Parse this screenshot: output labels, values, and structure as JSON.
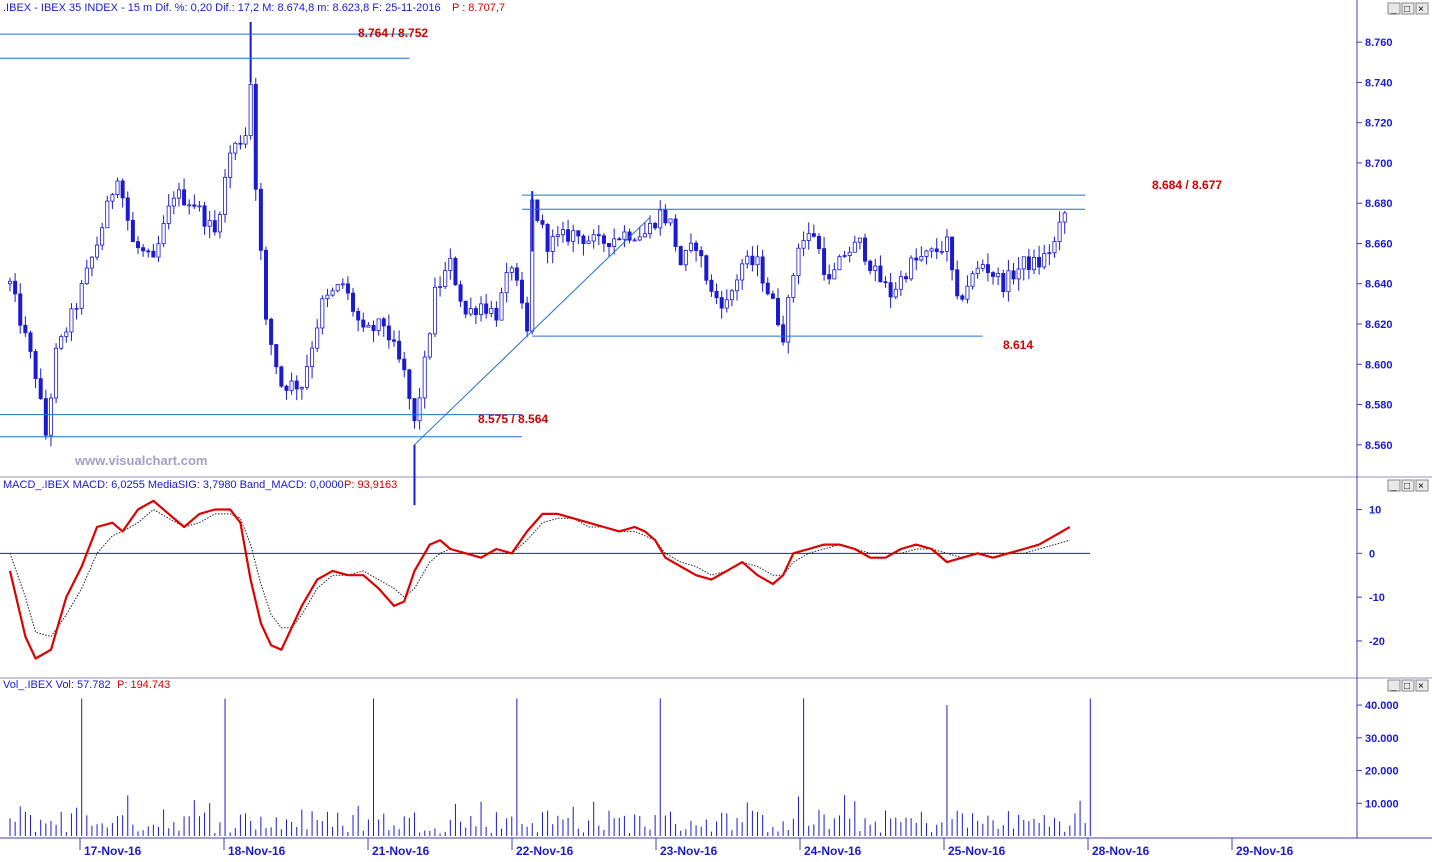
{
  "header": {
    "price_info": ".IBEX - IBEX 35 INDEX -  15 m  Dif. %: 0,20  Dif.: 17,2  M: 8.674,8  m: 8.623,8  F: 25-11-2016",
    "price_last": "P : 8.707,7",
    "macd_info": "MACD_.IBEX MACD: 6,0255  MediaSIG: 3,7980  Band_MACD: 0,0000",
    "macd_last": "P: 93,9163",
    "vol_info": "Vol_.IBEX Vol: 57.782",
    "vol_last": "P: 194.743"
  },
  "watermark": "www.visualchart.com",
  "window_buttons": [
    "_",
    "□",
    "×"
  ],
  "colors": {
    "price": "#1a1ad0",
    "macd": "#dd0000",
    "signal": "#202020",
    "trendline": "#1f6fd0",
    "annotation": "#d00000",
    "axis_text": "#1a1ad0",
    "frame": "#4040b0"
  },
  "annotations": {
    "a_top": "8.764 / 8.752",
    "a_mid": "8.684 / 8.677",
    "a_support": "8.614",
    "a_low": "8.575 / 8.564"
  },
  "chart_data": [
    {
      "type": "candlestick",
      "name": "IBEX 35 INDEX 15 m",
      "ylim": [
        8545,
        8772
      ],
      "yticks": [
        8560,
        8580,
        8600,
        8620,
        8640,
        8660,
        8680,
        8700,
        8720,
        8740,
        8760
      ],
      "ytick_labels": [
        "8.560",
        "8.580",
        "8.600",
        "8.620",
        "8.640",
        "8.660",
        "8.680",
        "8.700",
        "8.720",
        "8.740",
        "8.760"
      ],
      "x_dates": [
        "17-Nov-16",
        "18-Nov-16",
        "21-Nov-16",
        "22-Nov-16",
        "23-Nov-16",
        "24-Nov-16",
        "25-Nov-16",
        "28-Nov-16",
        "29-Nov-16"
      ],
      "bars_per_session": 35,
      "anchors": [
        [
          0,
          8640
        ],
        [
          5,
          8595
        ],
        [
          7,
          8565
        ],
        [
          9,
          8605
        ],
        [
          13,
          8630
        ],
        [
          17,
          8660
        ],
        [
          21,
          8695
        ],
        [
          24,
          8660
        ],
        [
          28,
          8650
        ],
        [
          32,
          8685
        ],
        [
          36,
          8680
        ],
        [
          40,
          8665
        ],
        [
          43,
          8705
        ],
        [
          46,
          8715
        ],
        [
          47,
          8740
        ],
        [
          48,
          8690
        ],
        [
          50,
          8620
        ],
        [
          53,
          8590
        ],
        [
          57,
          8590
        ],
        [
          61,
          8630
        ],
        [
          65,
          8640
        ],
        [
          69,
          8615
        ],
        [
          73,
          8620
        ],
        [
          77,
          8595
        ],
        [
          79,
          8570
        ],
        [
          81,
          8600
        ],
        [
          83,
          8635
        ],
        [
          86,
          8650
        ],
        [
          89,
          8625
        ],
        [
          92,
          8630
        ],
        [
          95,
          8625
        ],
        [
          98,
          8650
        ],
        [
          101,
          8615
        ],
        [
          102,
          8680
        ],
        [
          105,
          8660
        ],
        [
          110,
          8665
        ],
        [
          115,
          8660
        ],
        [
          120,
          8665
        ],
        [
          124,
          8665
        ],
        [
          127,
          8675
        ],
        [
          129,
          8670
        ],
        [
          131,
          8650
        ],
        [
          134,
          8660
        ],
        [
          137,
          8635
        ],
        [
          140,
          8630
        ],
        [
          143,
          8650
        ],
        [
          146,
          8650
        ],
        [
          149,
          8630
        ],
        [
          151,
          8615
        ],
        [
          154,
          8660
        ],
        [
          157,
          8665
        ],
        [
          160,
          8640
        ],
        [
          163,
          8655
        ],
        [
          166,
          8660
        ],
        [
          169,
          8645
        ],
        [
          172,
          8635
        ],
        [
          176,
          8650
        ],
        [
          180,
          8655
        ],
        [
          183,
          8660
        ],
        [
          185,
          8630
        ],
        [
          187,
          8640
        ],
        [
          190,
          8650
        ],
        [
          194,
          8640
        ],
        [
          198,
          8650
        ],
        [
          201,
          8650
        ],
        [
          204,
          8660
        ],
        [
          206,
          8675
        ]
      ],
      "lines": [
        {
          "label_key": "a_top",
          "levels": [
            8764,
            8752
          ],
          "from_bar": -2,
          "to_bar": 78
        },
        {
          "label_key": "a_mid",
          "levels": [
            8684,
            8677
          ],
          "from_bar": 100,
          "to_bar": 210
        },
        {
          "label_key": "a_support",
          "levels": [
            8614
          ],
          "from_bar": 102,
          "to_bar": 190
        },
        {
          "label_key": "a_low",
          "levels": [
            8575,
            8564
          ],
          "from_bar": -2,
          "to_bar": 100
        }
      ],
      "trendline": {
        "from": [
          79,
          8560
        ],
        "to": [
          125,
          8673
        ]
      }
    },
    {
      "type": "line",
      "name": "MACD",
      "ylim": [
        -28,
        14
      ],
      "yticks": [
        10,
        0,
        -10,
        -20
      ],
      "ytick_labels": [
        "10",
        "0",
        "-10",
        "-20"
      ],
      "zero_line": 0,
      "macd": [
        [
          0,
          -4
        ],
        [
          3,
          -19
        ],
        [
          5,
          -24
        ],
        [
          8,
          -22
        ],
        [
          11,
          -10
        ],
        [
          14,
          -3
        ],
        [
          17,
          6
        ],
        [
          20,
          7
        ],
        [
          22,
          5
        ],
        [
          25,
          10
        ],
        [
          28,
          12
        ],
        [
          31,
          9
        ],
        [
          34,
          6
        ],
        [
          37,
          9
        ],
        [
          40,
          10
        ],
        [
          43,
          10
        ],
        [
          45,
          7
        ],
        [
          47,
          -6
        ],
        [
          49,
          -16
        ],
        [
          51,
          -21
        ],
        [
          53,
          -22
        ],
        [
          55,
          -17
        ],
        [
          57,
          -12
        ],
        [
          60,
          -6
        ],
        [
          63,
          -4
        ],
        [
          66,
          -5
        ],
        [
          69,
          -5
        ],
        [
          72,
          -8
        ],
        [
          75,
          -12
        ],
        [
          77,
          -11
        ],
        [
          79,
          -4
        ],
        [
          82,
          2
        ],
        [
          84,
          3
        ],
        [
          86,
          1
        ],
        [
          89,
          0
        ],
        [
          92,
          -1
        ],
        [
          95,
          1
        ],
        [
          98,
          0
        ],
        [
          101,
          5
        ],
        [
          104,
          9
        ],
        [
          107,
          9
        ],
        [
          110,
          8
        ],
        [
          113,
          7
        ],
        [
          116,
          6
        ],
        [
          119,
          5
        ],
        [
          122,
          6
        ],
        [
          124,
          5
        ],
        [
          126,
          3
        ],
        [
          128,
          -1
        ],
        [
          131,
          -3
        ],
        [
          134,
          -5
        ],
        [
          137,
          -6
        ],
        [
          140,
          -4
        ],
        [
          143,
          -2
        ],
        [
          146,
          -5
        ],
        [
          149,
          -7
        ],
        [
          151,
          -5
        ],
        [
          153,
          0
        ],
        [
          156,
          1
        ],
        [
          159,
          2
        ],
        [
          162,
          2
        ],
        [
          165,
          1
        ],
        [
          168,
          -1
        ],
        [
          171,
          -1
        ],
        [
          174,
          1
        ],
        [
          177,
          2
        ],
        [
          180,
          1
        ],
        [
          183,
          -2
        ],
        [
          186,
          -1
        ],
        [
          189,
          0
        ],
        [
          192,
          -1
        ],
        [
          195,
          0
        ],
        [
          198,
          1
        ],
        [
          201,
          2
        ],
        [
          204,
          4
        ],
        [
          207,
          6
        ]
      ],
      "signal": [
        [
          0,
          0
        ],
        [
          3,
          -10
        ],
        [
          5,
          -18
        ],
        [
          8,
          -19
        ],
        [
          11,
          -14
        ],
        [
          14,
          -8
        ],
        [
          17,
          0
        ],
        [
          20,
          4
        ],
        [
          22,
          5
        ],
        [
          25,
          7
        ],
        [
          28,
          10
        ],
        [
          31,
          8
        ],
        [
          34,
          6
        ],
        [
          37,
          7
        ],
        [
          40,
          9
        ],
        [
          43,
          9
        ],
        [
          45,
          8
        ],
        [
          47,
          2
        ],
        [
          49,
          -7
        ],
        [
          51,
          -14
        ],
        [
          53,
          -17
        ],
        [
          55,
          -17
        ],
        [
          57,
          -14
        ],
        [
          60,
          -8
        ],
        [
          63,
          -5
        ],
        [
          66,
          -5
        ],
        [
          69,
          -4
        ],
        [
          72,
          -6
        ],
        [
          75,
          -8
        ],
        [
          77,
          -10
        ],
        [
          79,
          -8
        ],
        [
          82,
          -2
        ],
        [
          84,
          0
        ],
        [
          86,
          1
        ],
        [
          89,
          0
        ],
        [
          92,
          0
        ],
        [
          95,
          0
        ],
        [
          98,
          0
        ],
        [
          101,
          3
        ],
        [
          104,
          7
        ],
        [
          107,
          8
        ],
        [
          110,
          8
        ],
        [
          113,
          6
        ],
        [
          116,
          6
        ],
        [
          119,
          5
        ],
        [
          122,
          5
        ],
        [
          124,
          4
        ],
        [
          126,
          3
        ],
        [
          128,
          0
        ],
        [
          131,
          -2
        ],
        [
          134,
          -3
        ],
        [
          137,
          -5
        ],
        [
          140,
          -4
        ],
        [
          143,
          -2
        ],
        [
          146,
          -3
        ],
        [
          149,
          -5
        ],
        [
          151,
          -5
        ],
        [
          153,
          -2
        ],
        [
          156,
          0
        ],
        [
          159,
          1
        ],
        [
          162,
          2
        ],
        [
          165,
          1
        ],
        [
          168,
          0
        ],
        [
          171,
          0
        ],
        [
          174,
          0
        ],
        [
          177,
          1
        ],
        [
          180,
          1
        ],
        [
          183,
          0
        ],
        [
          186,
          -1
        ],
        [
          189,
          0
        ],
        [
          192,
          0
        ],
        [
          195,
          0
        ],
        [
          198,
          0
        ],
        [
          201,
          1
        ],
        [
          204,
          2
        ],
        [
          207,
          3
        ]
      ]
    },
    {
      "type": "bar",
      "name": "Volume",
      "ylim": [
        0,
        44000
      ],
      "yticks": [
        10000,
        20000,
        30000,
        40000
      ],
      "ytick_labels": [
        "10.000",
        "20.000",
        "30.000",
        "40.000"
      ],
      "open_spikes": [
        [
          14,
          42000
        ],
        [
          42,
          42000
        ],
        [
          71,
          42000
        ],
        [
          99,
          42000
        ],
        [
          127,
          42000
        ],
        [
          155,
          42000
        ],
        [
          183,
          40000
        ],
        [
          211,
          42000
        ]
      ],
      "typical_range": [
        800,
        8000
      ],
      "close_spike": [
        14.5,
        10000
      ]
    }
  ]
}
